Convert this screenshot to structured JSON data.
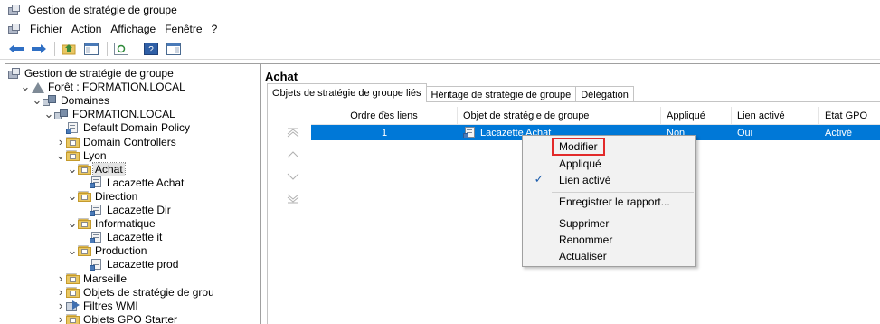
{
  "window": {
    "title": "Gestion de stratégie de groupe"
  },
  "menu": [
    "Fichier",
    "Action",
    "Affichage",
    "Fenêtre",
    "?"
  ],
  "tree": [
    {
      "label": "Gestion de stratégie de groupe",
      "depth": 0,
      "icon": "gpmc-icon",
      "expander": ""
    },
    {
      "label": "Forêt : FORMATION.LOCAL",
      "depth": 1,
      "icon": "forest-icon",
      "expander": "v"
    },
    {
      "label": "Domaines",
      "depth": 2,
      "icon": "domains-icon",
      "expander": "v"
    },
    {
      "label": "FORMATION.LOCAL",
      "depth": 3,
      "icon": "domain-icon",
      "expander": "v"
    },
    {
      "label": "Default Domain Policy",
      "depth": 4,
      "icon": "gpo-link-icon",
      "expander": ""
    },
    {
      "label": "Domain Controllers",
      "depth": 4,
      "icon": "ou-folder-icon",
      "expander": ">"
    },
    {
      "label": "Lyon",
      "depth": 4,
      "icon": "ou-folder-icon",
      "expander": "v"
    },
    {
      "label": "Achat",
      "depth": 5,
      "icon": "ou-folder-icon",
      "expander": "v",
      "selected": true
    },
    {
      "label": "Lacazette Achat",
      "depth": 6,
      "icon": "gpo-link-icon",
      "expander": ""
    },
    {
      "label": "Direction",
      "depth": 5,
      "icon": "ou-folder-icon",
      "expander": "v"
    },
    {
      "label": "Lacazette Dir",
      "depth": 6,
      "icon": "gpo-link-icon",
      "expander": ""
    },
    {
      "label": "Informatique",
      "depth": 5,
      "icon": "ou-folder-icon",
      "expander": "v"
    },
    {
      "label": "Lacazette it",
      "depth": 6,
      "icon": "gpo-link-icon",
      "expander": ""
    },
    {
      "label": "Production",
      "depth": 5,
      "icon": "ou-folder-icon",
      "expander": "v"
    },
    {
      "label": "Lacazette prod",
      "depth": 6,
      "icon": "gpo-link-icon",
      "expander": ""
    },
    {
      "label": "Marseille",
      "depth": 4,
      "icon": "ou-folder-icon",
      "expander": ">"
    },
    {
      "label": "Objets de stratégie de grou",
      "depth": 4,
      "icon": "gpo-container-icon",
      "expander": ">"
    },
    {
      "label": "Filtres WMI",
      "depth": 4,
      "icon": "wmi-filter-icon",
      "expander": ">"
    },
    {
      "label": "Objets GPO Starter",
      "depth": 4,
      "icon": "starter-gpo-icon",
      "expander": ">"
    }
  ],
  "right": {
    "title": "Achat",
    "tabs": [
      "Objets de stratégie de groupe liés",
      "Héritage de stratégie de groupe",
      "Délégation"
    ],
    "columns": [
      "Ordre des liens",
      "Objet de stratégie de groupe",
      "Appliqué",
      "Lien activé",
      "État GPO"
    ],
    "rows": [
      {
        "order": "1",
        "gpo": "Lacazette Achat",
        "enforced": "Non",
        "link_enabled": "Oui",
        "status": "Activé"
      }
    ]
  },
  "context_menu": {
    "items": [
      {
        "label": "Modifier",
        "highlighted": true
      },
      {
        "label": "Appliqué"
      },
      {
        "label": "Lien activé",
        "checked": true
      },
      {
        "label": "Enregistrer le rapport..."
      },
      {
        "label": "Supprimer"
      },
      {
        "label": "Renommer"
      },
      {
        "label": "Actualiser"
      }
    ]
  },
  "colors": {
    "selection": "#0078d7",
    "highlight_border": "#e22a2a"
  }
}
